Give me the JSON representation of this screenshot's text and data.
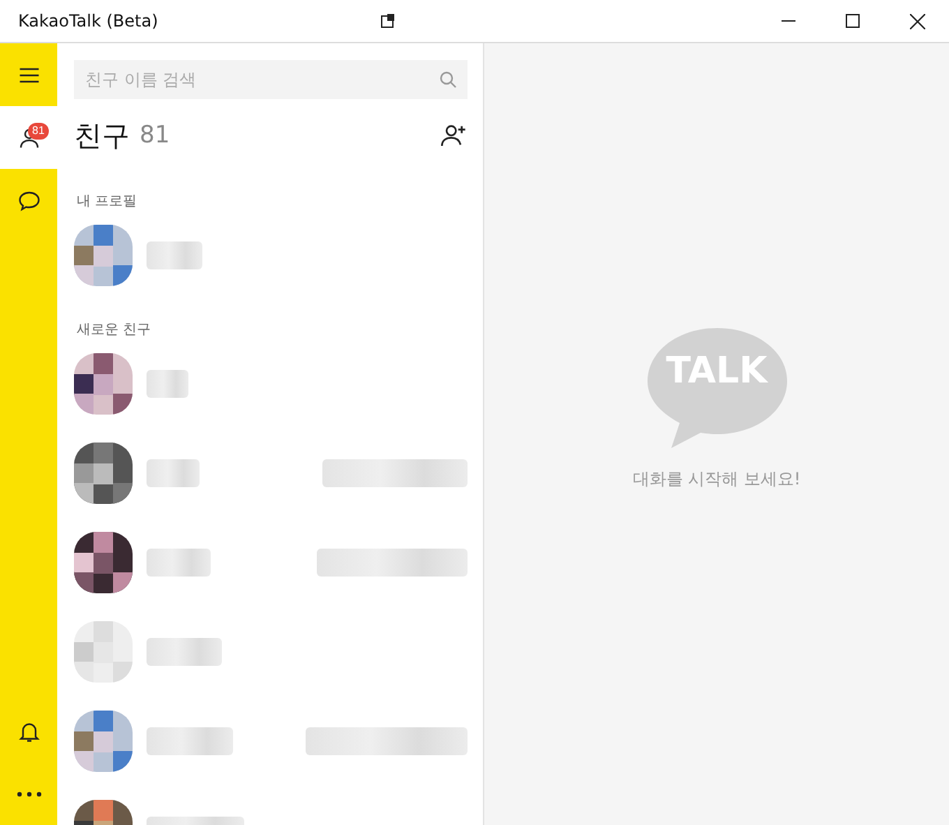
{
  "window": {
    "title": "KakaoTalk (Beta)"
  },
  "nav": [
    {
      "kind": "menu",
      "selected": false
    },
    {
      "kind": "friends",
      "selected": true,
      "badge": "81"
    },
    {
      "kind": "chat",
      "selected": false
    }
  ],
  "nav_bottom": [
    {
      "kind": "bell"
    },
    {
      "kind": "more"
    }
  ],
  "search": {
    "placeholder": "친구 이름 검색"
  },
  "header": {
    "title": "친구",
    "count": "81"
  },
  "sections": [
    {
      "title": "내 프로필",
      "rows": [
        {
          "status_shown": false
        }
      ]
    },
    {
      "title": "새로운 친구",
      "rows": [
        {
          "status_shown": false
        },
        {
          "status_shown": true
        },
        {
          "status_shown": true
        },
        {
          "status_shown": false
        },
        {
          "status_shown": true
        },
        {
          "status_shown": false
        }
      ]
    }
  ],
  "empty_state": {
    "logo": "TALK",
    "message": "대화를 시작해 보세요!"
  }
}
